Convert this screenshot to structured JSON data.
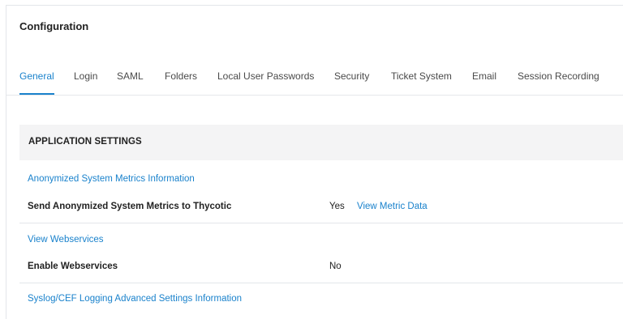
{
  "page": {
    "title": "Configuration"
  },
  "tabs": [
    {
      "label": "General",
      "active": true
    },
    {
      "label": "Login",
      "active": false
    },
    {
      "label": "SAML",
      "active": false
    },
    {
      "label": "Folders",
      "active": false
    },
    {
      "label": "Local User Passwords",
      "active": false
    },
    {
      "label": "Security",
      "active": false
    },
    {
      "label": "Ticket System",
      "active": false
    },
    {
      "label": "Email",
      "active": false
    },
    {
      "label": "Session Recording",
      "active": false
    }
  ],
  "section": {
    "title": "APPLICATION SETTINGS"
  },
  "settings": {
    "metrics_info_link": "Anonymized System Metrics Information",
    "metrics_label": "Send Anonymized System Metrics to Thycotic",
    "metrics_value": "Yes",
    "metrics_view_link": "View Metric Data",
    "webservices_link": "View Webservices",
    "webservices_label": "Enable Webservices",
    "webservices_value": "No",
    "syslog_link": "Syslog/CEF Logging Advanced Settings Information"
  },
  "colors": {
    "accent": "#1a82cc",
    "section_bg": "#f4f4f5",
    "divider": "#e3e6ea"
  }
}
